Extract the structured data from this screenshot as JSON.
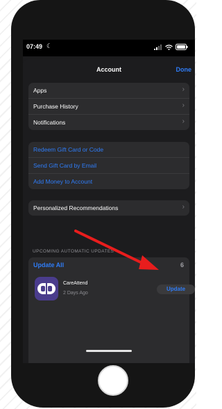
{
  "status_bar": {
    "time": "07:49"
  },
  "nav": {
    "title": "Account",
    "done": "Done"
  },
  "group1": [
    {
      "label": "Apps"
    },
    {
      "label": "Purchase History"
    },
    {
      "label": "Notifications"
    }
  ],
  "group2": [
    {
      "label": "Redeem Gift Card or Code"
    },
    {
      "label": "Send Gift Card by Email"
    },
    {
      "label": "Add Money to Account"
    }
  ],
  "group3": {
    "label": "Personalized Recommendations"
  },
  "updates": {
    "section_header": "UPCOMING AUTOMATIC UPDATES",
    "update_all": "Update All",
    "count": "6",
    "app": {
      "name": "CareAttend",
      "date": "2 Days Ago",
      "button": "Update"
    }
  },
  "colors": {
    "accent": "#2f7cf6",
    "arrow": "#e81d1d",
    "app_icon": "#4a3c8c"
  }
}
